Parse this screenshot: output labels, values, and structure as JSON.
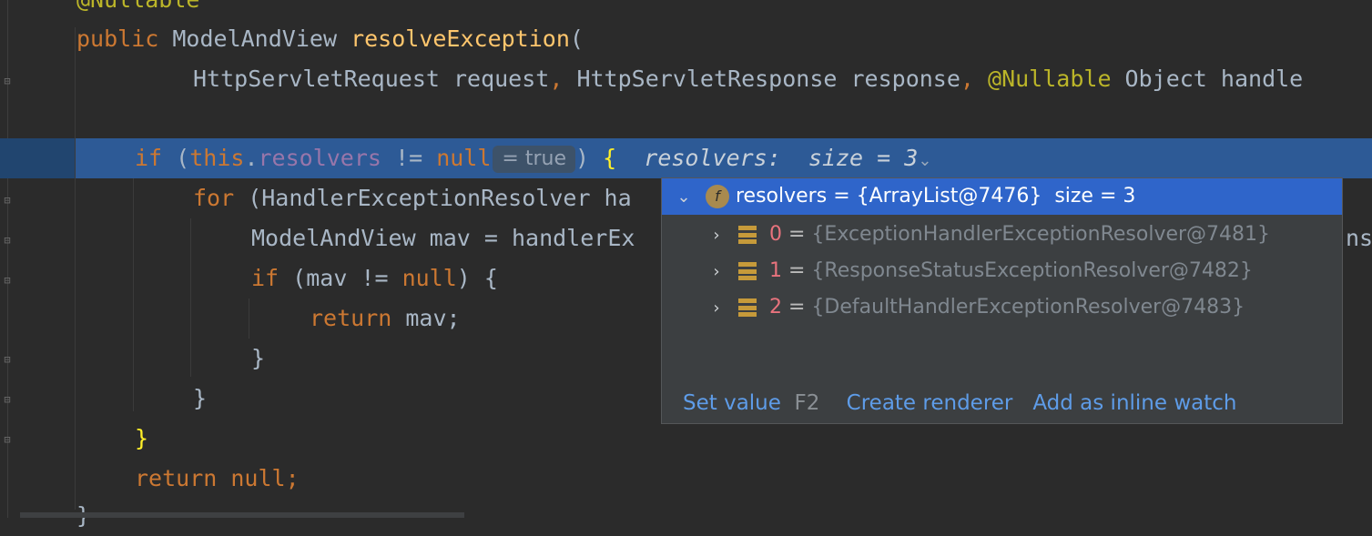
{
  "editor": {
    "lines": {
      "l0": {
        "ann": "@Nullable"
      },
      "l1": {
        "kw": "public",
        "type": "ModelAndView",
        "fn": "resolveException",
        "paren": "("
      },
      "l2": {
        "t1": "HttpServletRequest request",
        "c1": ",",
        "t2": " HttpServletResponse response",
        "c2": ",",
        "ann": "@Nullable",
        "t3": " Object handle"
      },
      "l4": {
        "kw": "if",
        "p": " (",
        "this": "this",
        "dot": ".",
        "fld": "resolvers",
        "op": " != ",
        "nul": "null",
        "close": ") ",
        "brace": "{"
      },
      "l5": {
        "kw": "for",
        "rest": " (HandlerExceptionResolver ha"
      },
      "l6": {
        "rest": "ModelAndView mav = handlerEx",
        "tail": "ns"
      },
      "l7": {
        "kw": "if",
        "rest": " (mav != ",
        "nul": "null",
        "end": ") {"
      },
      "l8": {
        "kw": "return",
        "rest": " mav;"
      },
      "l9": {
        "rest": "}"
      },
      "l10": {
        "rest": "}"
      },
      "l11": {
        "brace": "}"
      },
      "l12": {
        "kw": "return",
        "nul": " null",
        "end": ";"
      },
      "l13": {
        "rest": "}"
      }
    },
    "inline_value": "= true",
    "hint": {
      "label": "resolvers:",
      "value": "size = 3"
    }
  },
  "popup": {
    "root": {
      "icon": "f",
      "name": "resolvers",
      "eq": " = ",
      "value": "{ArrayList@7476}",
      "size": "  size = 3"
    },
    "items": [
      {
        "index": "0",
        "eq": " = ",
        "value": "{ExceptionHandlerExceptionResolver@7481}"
      },
      {
        "index": "1",
        "eq": " = ",
        "value": "{ResponseStatusExceptionResolver@7482}"
      },
      {
        "index": "2",
        "eq": " = ",
        "value": "{DefaultHandlerExceptionResolver@7483}"
      }
    ],
    "actions": {
      "set_value": "Set value",
      "set_value_key": "F2",
      "create_renderer": "Create renderer",
      "add_inline_watch": "Add as inline watch"
    }
  }
}
